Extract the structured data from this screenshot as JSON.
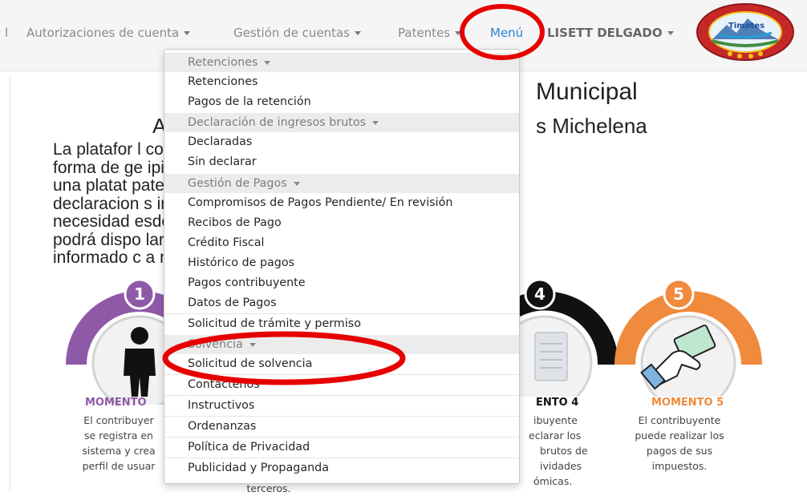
{
  "navbar": {
    "partial_item": "l",
    "autorizaciones": "Autorizaciones de cuenta",
    "gestion_cuentas": "Gestión de cuentas",
    "patentes": "Patentes",
    "menu": "Menú",
    "user": "LISETT DELGADO",
    "logo_icon": "municipality-seal-icon",
    "logo_text": "Timotes"
  },
  "page": {
    "title_right": "Municipal",
    "subtitle_left": "A",
    "subtitle_right": "s Michelena",
    "intro_lines": [
      "La platafor                                       l contribuyente una nueva",
      "forma de ge                                       ipio poniendo a su servicio",
      "una    platat                                          patentes,    realizar    sus",
      "declaracion                                       s  impuestos  en  línea  sin",
      "necesidad                                          esde su negocio. Ademas",
      "podrá dispo                                       laraciones y le mantendrá",
      "informado c                                      a mantenerse al día."
    ],
    "info_icon": "info-icon"
  },
  "moments": {
    "m1": {
      "number": "1",
      "title": "MOMENTO",
      "text": [
        "El contribuyer",
        "se registra en",
        "sistema y crea",
        "perfil de usuar"
      ],
      "color": "#8e5aa8",
      "icon": "person-icon"
    },
    "m4": {
      "number": "4",
      "title": "ENTO 4",
      "text": [
        "ibuyente",
        "eclarar los",
        "brutos de",
        "ividades",
        "ómicas."
      ],
      "color": "#111111",
      "icon": "document-icon"
    },
    "m5": {
      "number": "5",
      "title": "MOMENTO 5",
      "text": [
        "El contribuyente",
        "puede realizar los",
        "pagos de sus",
        "impuestos."
      ],
      "color": "#f08a3c",
      "icon": "payment-card-hand-icon"
    },
    "under_text": "terceros."
  },
  "dropdown": {
    "rows": [
      {
        "type": "header",
        "label": "Retenciones"
      },
      {
        "type": "item",
        "label": "Retenciones"
      },
      {
        "type": "item",
        "label": "Pagos de la retención"
      },
      {
        "type": "header",
        "label": "Declaración de ingresos brutos"
      },
      {
        "type": "item",
        "label": "Declaradas"
      },
      {
        "type": "item",
        "label": "Sin declarar"
      },
      {
        "type": "header",
        "label": "Gestión de Pagos"
      },
      {
        "type": "item",
        "label": "Compromisos de Pagos Pendiente/ En revisión"
      },
      {
        "type": "item",
        "label": "Recibos de Pago"
      },
      {
        "type": "item",
        "label": "Crédito Fiscal"
      },
      {
        "type": "item",
        "label": "Histórico de pagos"
      },
      {
        "type": "item",
        "label": "Pagos contribuyente"
      },
      {
        "type": "item",
        "label": "Datos de Pagos"
      },
      {
        "type": "item",
        "label": "Solicitud de trámite y permiso"
      },
      {
        "type": "header",
        "label": "Solvencia"
      },
      {
        "type": "item",
        "label": "Solicitud de solvencia"
      },
      {
        "type": "item",
        "label": "Contáctenos"
      },
      {
        "type": "item",
        "label": "Instructivos"
      },
      {
        "type": "item",
        "label": "Ordenanzas"
      },
      {
        "type": "item",
        "label": "Política de Privacidad"
      },
      {
        "type": "item",
        "label": "Publicidad y Propaganda"
      }
    ]
  },
  "colors": {
    "accent": "#2a7fd4",
    "annotation": "#e60000"
  }
}
